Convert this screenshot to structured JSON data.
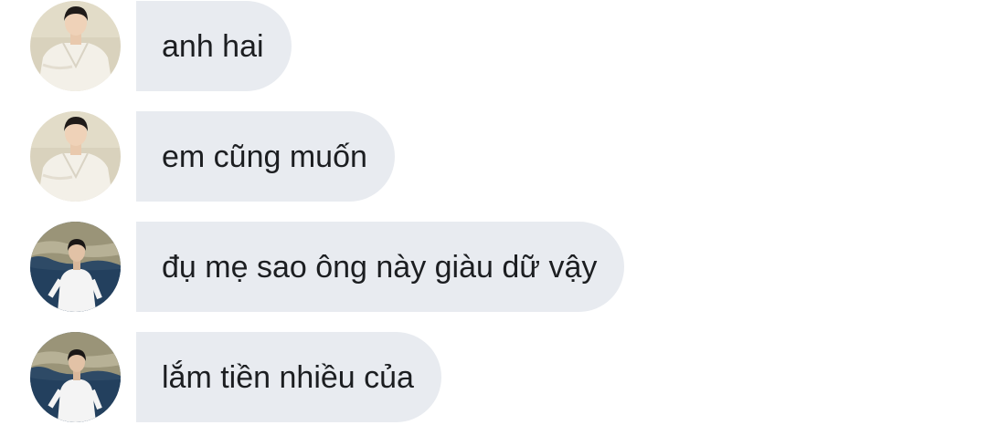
{
  "chat": {
    "messages": [
      {
        "sender_avatar": "avatar-white-robe",
        "text": "anh hai"
      },
      {
        "sender_avatar": "avatar-white-robe",
        "text": "em cũng muốn"
      },
      {
        "sender_avatar": "avatar-seaside-white-shirt",
        "text": "đụ mẹ sao ông này giàu dữ vậy"
      },
      {
        "sender_avatar": "avatar-seaside-white-shirt",
        "text": "lắm tiền nhiều của"
      }
    ]
  },
  "colors": {
    "bubble_bg": "#e8ebf0",
    "text": "#1c1e21",
    "background": "#ffffff"
  }
}
